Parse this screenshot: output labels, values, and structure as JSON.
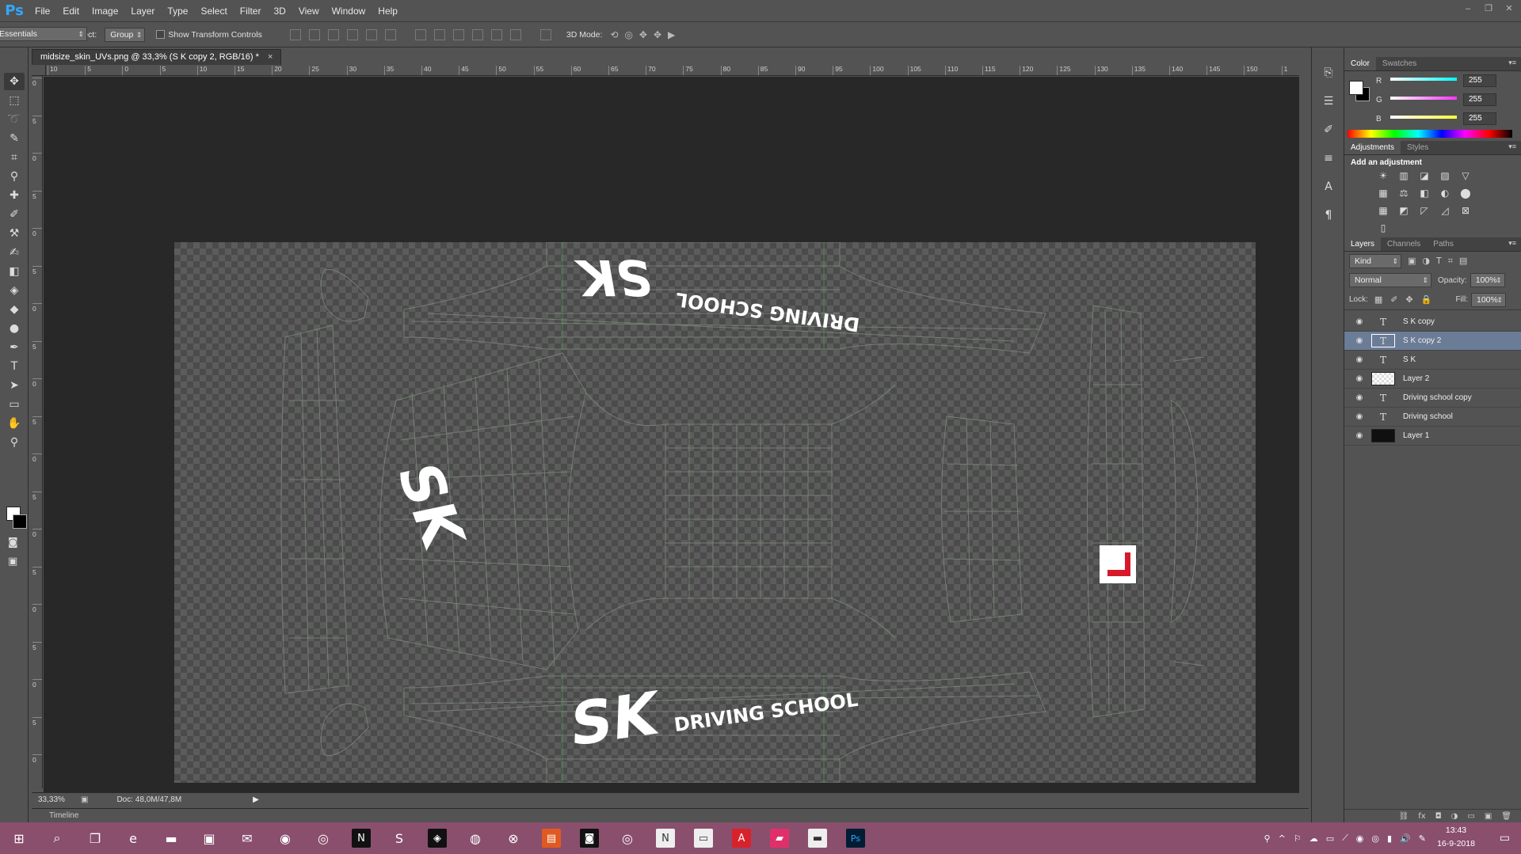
{
  "app": {
    "logo": "Ps"
  },
  "menu": [
    "File",
    "Edit",
    "Image",
    "Layer",
    "Type",
    "Select",
    "Filter",
    "3D",
    "View",
    "Window",
    "Help"
  ],
  "window_controls": [
    "–",
    "❐",
    "✕"
  ],
  "options": {
    "auto_select_label": "Auto-Select:",
    "auto_select_value": "Group",
    "show_transform_label": "Show Transform Controls",
    "mode_3d_label": "3D Mode:",
    "workspace": "Essentials"
  },
  "document": {
    "tab_title": "midsize_skin_UVs.png @ 33,3% (S K copy 2, RGB/16) *",
    "close": "×"
  },
  "ruler": {
    "h_ticks": [
      "10",
      "5",
      "0",
      "5",
      "10",
      "15",
      "20",
      "25",
      "30",
      "35",
      "40",
      "45",
      "50",
      "55",
      "60",
      "65",
      "70",
      "75",
      "80",
      "85",
      "90",
      "95",
      "100",
      "105",
      "110",
      "115",
      "120",
      "125",
      "130",
      "135",
      "140",
      "145",
      "150",
      "1"
    ],
    "v_ticks": [
      "0",
      "5",
      "0",
      "5",
      "0",
      "5",
      "0",
      "5",
      "0",
      "5",
      "0",
      "5",
      "0",
      "5",
      "0",
      "5",
      "0",
      "5",
      "0"
    ]
  },
  "artwork": {
    "sk_top": "SK",
    "driving_top": "DRIVING SCHOOL",
    "sk_left": "SK",
    "sk_bottom": "SK",
    "driving_bottom": "DRIVING SCHOOL"
  },
  "status": {
    "zoom": "33,33%",
    "doc": "Doc: 48,0M/47,8M"
  },
  "timeline_label": "Timeline",
  "color_panel": {
    "tabs": [
      "Color",
      "Swatches"
    ],
    "r_label": "R",
    "g_label": "G",
    "b_label": "B",
    "r": "255",
    "g": "255",
    "b": "255",
    "colors": {
      "r": "#00ffff",
      "g": "#ff33ff",
      "b": "#ffff33"
    }
  },
  "adjustments_panel": {
    "tabs": [
      "Adjustments",
      "Styles"
    ],
    "heading": "Add an adjustment",
    "icons": [
      "☀",
      "▥",
      "◪",
      "▨",
      "▽",
      "▦",
      "⚖",
      "◧",
      "◐",
      "⬤",
      "▦",
      "◩",
      "◸",
      "◿",
      "⊠",
      "▯"
    ]
  },
  "layers_panel": {
    "tabs": [
      "Layers",
      "Channels",
      "Paths"
    ],
    "kind": "Kind",
    "blend_mode": "Normal",
    "opacity_label": "Opacity:",
    "opacity": "100%",
    "lock_label": "Lock:",
    "fill_label": "Fill:",
    "fill": "100%",
    "layers": [
      {
        "name": "S K copy",
        "type": "text",
        "selected": false
      },
      {
        "name": "S K copy 2",
        "type": "text",
        "selected": true
      },
      {
        "name": "S K",
        "type": "text",
        "selected": false
      },
      {
        "name": "Layer 2",
        "type": "checker",
        "selected": false
      },
      {
        "name": "Driving school copy",
        "type": "text",
        "selected": false
      },
      {
        "name": "Driving school",
        "type": "text",
        "selected": false
      },
      {
        "name": "Layer 1",
        "type": "dark",
        "selected": false
      }
    ],
    "footer_icons": [
      "⛓",
      "fx",
      "◘",
      "◑",
      "▭",
      "▣",
      "🗑"
    ]
  },
  "taskbar": {
    "apps": [
      {
        "name": "start-icon",
        "glyph": "⊞",
        "bg": ""
      },
      {
        "name": "search-icon",
        "glyph": "⌕",
        "bg": ""
      },
      {
        "name": "task-view-icon",
        "glyph": "❐",
        "bg": ""
      },
      {
        "name": "edge-icon",
        "glyph": "e",
        "bg": ""
      },
      {
        "name": "file-explorer-icon",
        "glyph": "▬",
        "bg": ""
      },
      {
        "name": "store-icon",
        "glyph": "▣",
        "bg": ""
      },
      {
        "name": "mail-icon",
        "glyph": "✉",
        "bg": ""
      },
      {
        "name": "discord-icon",
        "glyph": "◉",
        "bg": ""
      },
      {
        "name": "steam-icon",
        "glyph": "◎",
        "bg": ""
      },
      {
        "name": "netflix-icon",
        "glyph": "N",
        "bg": "#111111"
      },
      {
        "name": "skype-icon",
        "glyph": "S",
        "bg": ""
      },
      {
        "name": "steam-alt-icon",
        "glyph": "◈",
        "bg": "#111111"
      },
      {
        "name": "spotify-icon",
        "glyph": "◍",
        "bg": ""
      },
      {
        "name": "xbox-icon",
        "glyph": "⊗",
        "bg": ""
      },
      {
        "name": "origin-icon",
        "glyph": "▤",
        "bg": "#e05a20"
      },
      {
        "name": "camera-icon",
        "glyph": "◙",
        "bg": "#111111"
      },
      {
        "name": "groove-icon",
        "glyph": "◎",
        "bg": ""
      },
      {
        "name": "news-icon",
        "glyph": "N",
        "bg": "#eeeeee"
      },
      {
        "name": "app-box-icon",
        "glyph": "▭",
        "bg": "#eeeeee"
      },
      {
        "name": "acrobat-icon",
        "glyph": "A",
        "bg": "#d8222b"
      },
      {
        "name": "forza-icon",
        "glyph": "▰",
        "bg": "#e0306a"
      },
      {
        "name": "browser-icon",
        "glyph": "▬",
        "bg": "#eeeeee"
      },
      {
        "name": "photoshop-icon",
        "glyph": "Ps",
        "bg": "#001d34"
      }
    ],
    "tray": [
      "⚲",
      "^",
      "⚐",
      "☁",
      "▭",
      "⟋",
      "◉",
      "◎",
      "▮",
      "🔊",
      "✎"
    ],
    "time": "13:43",
    "date": "16-9-2018",
    "notification": "▭"
  }
}
